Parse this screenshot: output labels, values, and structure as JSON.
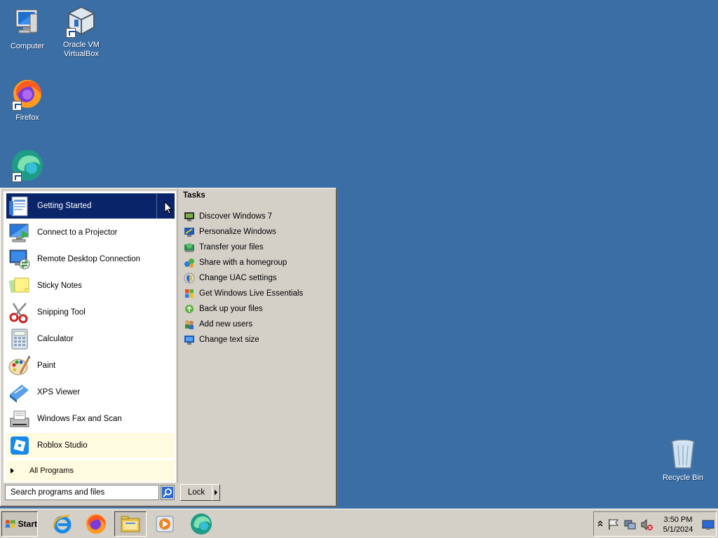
{
  "desktop": {
    "icons": [
      {
        "label": "Computer",
        "icon": "computer-icon"
      },
      {
        "label": "Oracle VM VirtualBox",
        "icon": "virtualbox-icon"
      },
      {
        "label": "Firefox",
        "icon": "firefox-icon"
      },
      {
        "label": "",
        "icon": "edge-icon"
      },
      {
        "label": "Recycle Bin",
        "icon": "recycle-bin-icon"
      }
    ]
  },
  "start_menu": {
    "programs": [
      {
        "label": "Getting Started",
        "icon": "getting-started-icon"
      },
      {
        "label": "Connect to a Projector",
        "icon": "projector-icon"
      },
      {
        "label": "Remote Desktop Connection",
        "icon": "remote-desktop-icon"
      },
      {
        "label": "Sticky Notes",
        "icon": "sticky-notes-icon"
      },
      {
        "label": "Snipping Tool",
        "icon": "snipping-tool-icon"
      },
      {
        "label": "Calculator",
        "icon": "calculator-icon"
      },
      {
        "label": "Paint",
        "icon": "paint-icon"
      },
      {
        "label": "XPS Viewer",
        "icon": "xps-viewer-icon"
      },
      {
        "label": "Windows Fax and Scan",
        "icon": "fax-scan-icon"
      },
      {
        "label": "Roblox Studio",
        "icon": "roblox-studio-icon"
      }
    ],
    "all_programs": "All Programs",
    "tasks_title": "Tasks",
    "tasks": [
      {
        "label": "Discover Windows 7"
      },
      {
        "label": "Personalize Windows"
      },
      {
        "label": "Transfer your files"
      },
      {
        "label": "Share with a homegroup"
      },
      {
        "label": "Change UAC settings"
      },
      {
        "label": "Get Windows Live Essentials"
      },
      {
        "label": "Back up your files"
      },
      {
        "label": "Add new users"
      },
      {
        "label": "Change text size"
      }
    ],
    "search_placeholder": "Search programs and files",
    "lock_label": "Lock"
  },
  "taskbar": {
    "start_label": "Start",
    "pinned": [
      "internet-explorer-icon",
      "firefox-icon",
      "file-explorer-icon",
      "media-player-icon",
      "edge-icon"
    ],
    "clock": {
      "time": "3:50 PM",
      "date": "5/1/2024"
    }
  }
}
